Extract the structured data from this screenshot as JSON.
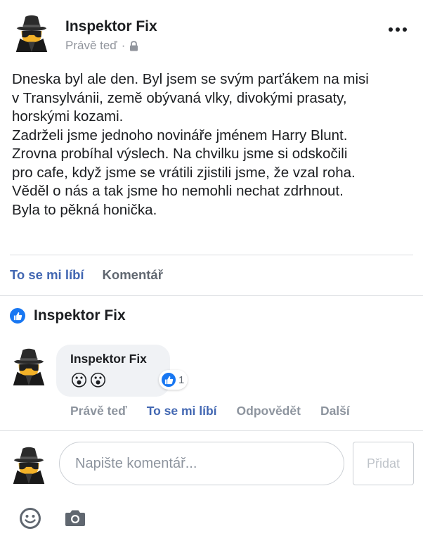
{
  "post": {
    "author": "Inspektor Fix",
    "timestamp": "Právě teď",
    "separator": "·",
    "privacy_icon": "lock-icon",
    "more_icon": "more-dots-icon",
    "body_lines": [
      "Dneska byl ale den. Byl jsem se svým parťákem na misi",
      "v Transylvánii, země obývaná vlky, divokými prasaty,",
      "horskými kozami.",
      "Zadrželi jsme jednoho novináře jménem Harry Blunt.",
      "Zrovna probíhal výslech. Na chvilku jsme si odskočili",
      "pro cafe, když jsme se vrátili zjistili jsme, že vzal roha.",
      "Věděl o nás a tak jsme ho nemohli nechat zdrhnout.",
      "Byla to pěkná honička."
    ]
  },
  "actions": {
    "like": "To se mi líbí",
    "comment": "Komentář"
  },
  "likes": {
    "icon": "like-thumb-icon",
    "names": "Inspektor Fix"
  },
  "comment": {
    "author": "Inspektor Fix",
    "text": "😮😮",
    "reaction_icon": "like-thumb-icon",
    "reaction_count": "1",
    "time": "Právě teď",
    "like": "To se mi líbí",
    "reply": "Odpovědět",
    "more": "Další"
  },
  "composer": {
    "placeholder": "Napište komentář...",
    "submit": "Přidat",
    "emoji_icon": "emoji-icon",
    "camera_icon": "camera-icon"
  },
  "colors": {
    "link_blue": "#4267b2",
    "like_badge": "#1877f2",
    "muted": "#8d949e"
  }
}
